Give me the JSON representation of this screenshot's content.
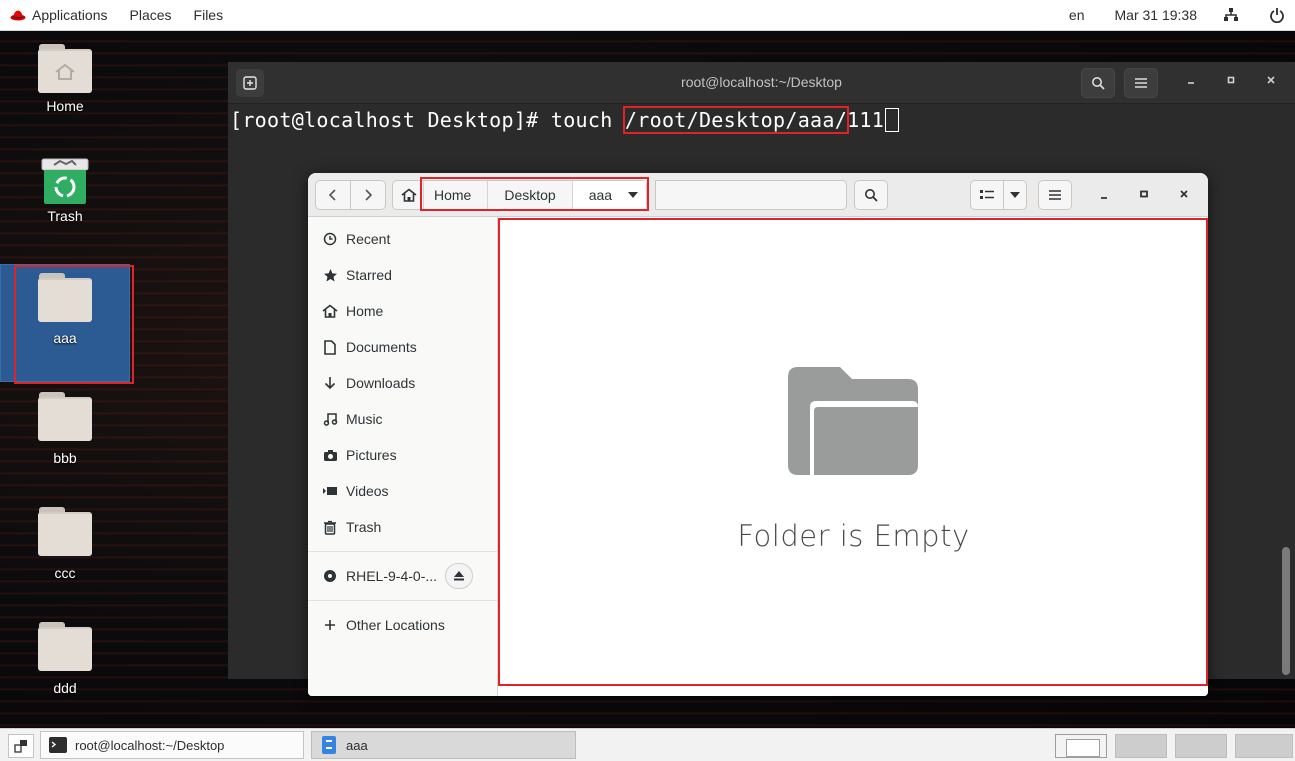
{
  "topbar": {
    "applications": "Applications",
    "places": "Places",
    "files": "Files",
    "lang": "en",
    "clock": "Mar 31 19:38"
  },
  "desktop": {
    "icons": [
      {
        "label": "Home"
      },
      {
        "label": "Trash"
      },
      {
        "label": "aaa"
      },
      {
        "label": "bbb"
      },
      {
        "label": "ccc"
      },
      {
        "label": "ddd"
      }
    ]
  },
  "terminal": {
    "title": "root@localhost:~/Desktop",
    "prompt": "[root@localhost Desktop]# touch ",
    "highlighted_path": "/root/Desktop/aaa/",
    "typed_suffix": "111"
  },
  "files": {
    "breadcrumb": [
      "Home",
      "Desktop",
      "aaa"
    ],
    "sidebar": [
      {
        "label": "Recent",
        "icon": "clock-icon"
      },
      {
        "label": "Starred",
        "icon": "star-icon"
      },
      {
        "label": "Home",
        "icon": "home-icon"
      },
      {
        "label": "Documents",
        "icon": "document-icon"
      },
      {
        "label": "Downloads",
        "icon": "download-icon"
      },
      {
        "label": "Music",
        "icon": "music-icon"
      },
      {
        "label": "Pictures",
        "icon": "camera-icon"
      },
      {
        "label": "Videos",
        "icon": "video-icon"
      },
      {
        "label": "Trash",
        "icon": "trash-icon"
      }
    ],
    "device": "RHEL-9-4-0-...",
    "other_locations": "Other Locations",
    "empty_message": "Folder is Empty"
  },
  "taskbar": {
    "tasks": [
      {
        "label": "root@localhost:~/Desktop"
      },
      {
        "label": "aaa"
      }
    ]
  },
  "colors": {
    "highlight_box": "#e0222a",
    "selected_icon_bg": "#2c5b93",
    "terminal_bg": "#2b2b2b"
  }
}
